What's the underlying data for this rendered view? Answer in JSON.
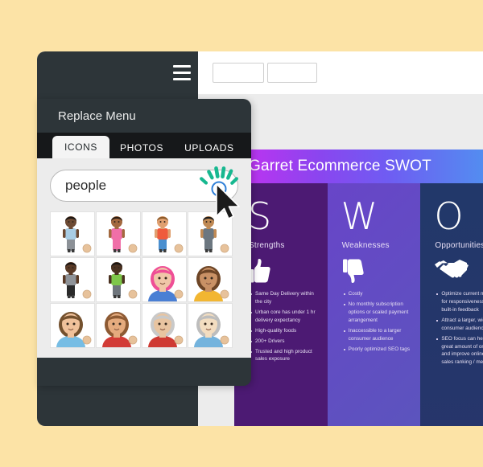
{
  "theme": {
    "page_background": "#fce3a6",
    "panel_dark": "#2d3539",
    "tabbar_dark": "#16181a",
    "workspace_gray": "#ececec",
    "accent_green": "#17b890",
    "accent_blue": "#2f7fd8",
    "swot_strengths_color": "#4c1a73",
    "swot_weaknesses_color": "#6845c8",
    "swot_opportunities_color": "#22386a"
  },
  "toolbar": {
    "menu_icon": "hamburger-icon",
    "box_1_value": "",
    "box_2_value": ""
  },
  "panel": {
    "title": "Replace Menu",
    "tabs": [
      {
        "label": "ICONS",
        "active": true
      },
      {
        "label": "PHOTOS",
        "active": false
      },
      {
        "label": "UPLOADS",
        "active": false
      }
    ],
    "search": {
      "value": "people",
      "placeholder": "Search"
    },
    "results": [
      {
        "name": "person-standing-dark-skin",
        "skin": "#6d4a33",
        "hair": "#1a1512",
        "shirt": "#a9cde4",
        "pants": "#8c9197",
        "type": "full"
      },
      {
        "name": "girl-waving-pink-dress",
        "skin": "#a3693f",
        "hair": "#2b1d13",
        "shirt": "#f06fa8",
        "pants": "#f06fa8",
        "type": "full"
      },
      {
        "name": "boy-waving-red-shirt",
        "skin": "#e0a070",
        "hair": "#8a5a2b",
        "shirt": "#ef5b3c",
        "pants": "#4a8fcf",
        "type": "full"
      },
      {
        "name": "man-turban-beard",
        "skin": "#c08a55",
        "hair": "#1c1c1c",
        "shirt": "#6c7780",
        "pants": "#6c7780",
        "type": "full"
      },
      {
        "name": "woman-long-dress-dark",
        "skin": "#5a3a26",
        "hair": "#1a1512",
        "shirt": "#8f9398",
        "pants": "#2a2a2a",
        "type": "full"
      },
      {
        "name": "person-wheelchair",
        "skin": "#4a3120",
        "hair": "#1a1512",
        "shirt": "#7ec64a",
        "pants": "#6e757c",
        "type": "full"
      },
      {
        "name": "woman-pink-hair-bust",
        "skin": "#f0c7a8",
        "hair": "#ef4f96",
        "shirt": "#4a7fd4",
        "type": "bust"
      },
      {
        "name": "woman-brown-hair-bust",
        "skin": "#c99165",
        "hair": "#6d4526",
        "shirt": "#f2b632",
        "type": "bust"
      },
      {
        "name": "man-glasses-bust",
        "skin": "#f0c19a",
        "hair": "#74512e",
        "shirt": "#77bde4",
        "type": "bust"
      },
      {
        "name": "woman-ponytail-bust",
        "skin": "#e5ab7e",
        "hair": "#8d5a33",
        "shirt": "#d23b36",
        "type": "bust"
      },
      {
        "name": "older-man-beard-bust",
        "skin": "#e8c4a0",
        "hair": "#c9c9c9",
        "shirt": "#cf3a33",
        "type": "bust"
      },
      {
        "name": "bald-man-mustache-bust",
        "skin": "#f3ddc0",
        "hair": "#bdbdbd",
        "shirt": "#74b3dd",
        "type": "bust"
      }
    ]
  },
  "swot": {
    "title": "Garret Ecommerce SWOT",
    "columns": [
      {
        "letter": "S",
        "label": "Strengths",
        "icon": "thumbs-up-icon",
        "bullets": [
          "Same Day Delivery within the city",
          "Urban core has under 1 hr delivery expectancy",
          "High-quality foods",
          "200+ Drivers",
          "Trusted and high product sales exposure"
        ]
      },
      {
        "letter": "W",
        "label": "Weaknesses",
        "icon": "thumbs-down-icon",
        "bullets": [
          "Costly",
          "No monthly subscription options or scaled payment arrangement",
          "Inaccessible to a larger consumer audience",
          "Poorly optimized SEO tags"
        ]
      },
      {
        "letter": "O",
        "label": "Opportunities",
        "icon": "handshake-icon",
        "bullets": [
          "Optimize current mobile app for responsiveness and built-in feedback",
          "Attract a larger, wider target consumer audience",
          "SEO focus can help drive a great amount of online traffic and improve online product sales ranking / metrics"
        ]
      }
    ]
  },
  "cursor": {
    "name": "click-cursor-effect",
    "state": "clicked"
  }
}
